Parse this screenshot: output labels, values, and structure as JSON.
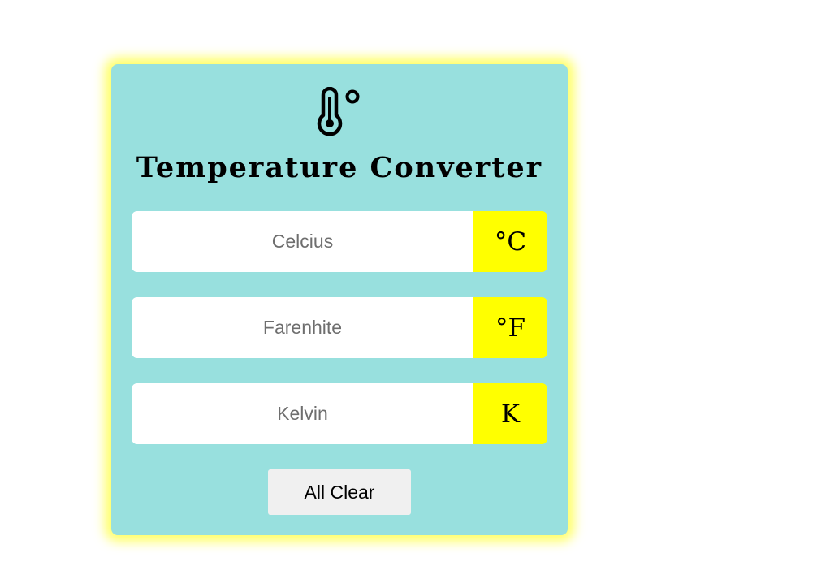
{
  "app": {
    "title": "Temperature Converter",
    "icon": "thermometer-degree-icon"
  },
  "fields": [
    {
      "placeholder": "Celcius",
      "value": "",
      "unit": "°C"
    },
    {
      "placeholder": "Farenhite",
      "value": "",
      "unit": "°F"
    },
    {
      "placeholder": "Kelvin",
      "value": "",
      "unit": "K"
    }
  ],
  "actions": {
    "clear_label": "All Clear"
  },
  "colors": {
    "card_background": "#98e0de",
    "card_glow": "#ffff66",
    "unit_background": "#ffff00",
    "button_background": "#f0f0f0"
  }
}
